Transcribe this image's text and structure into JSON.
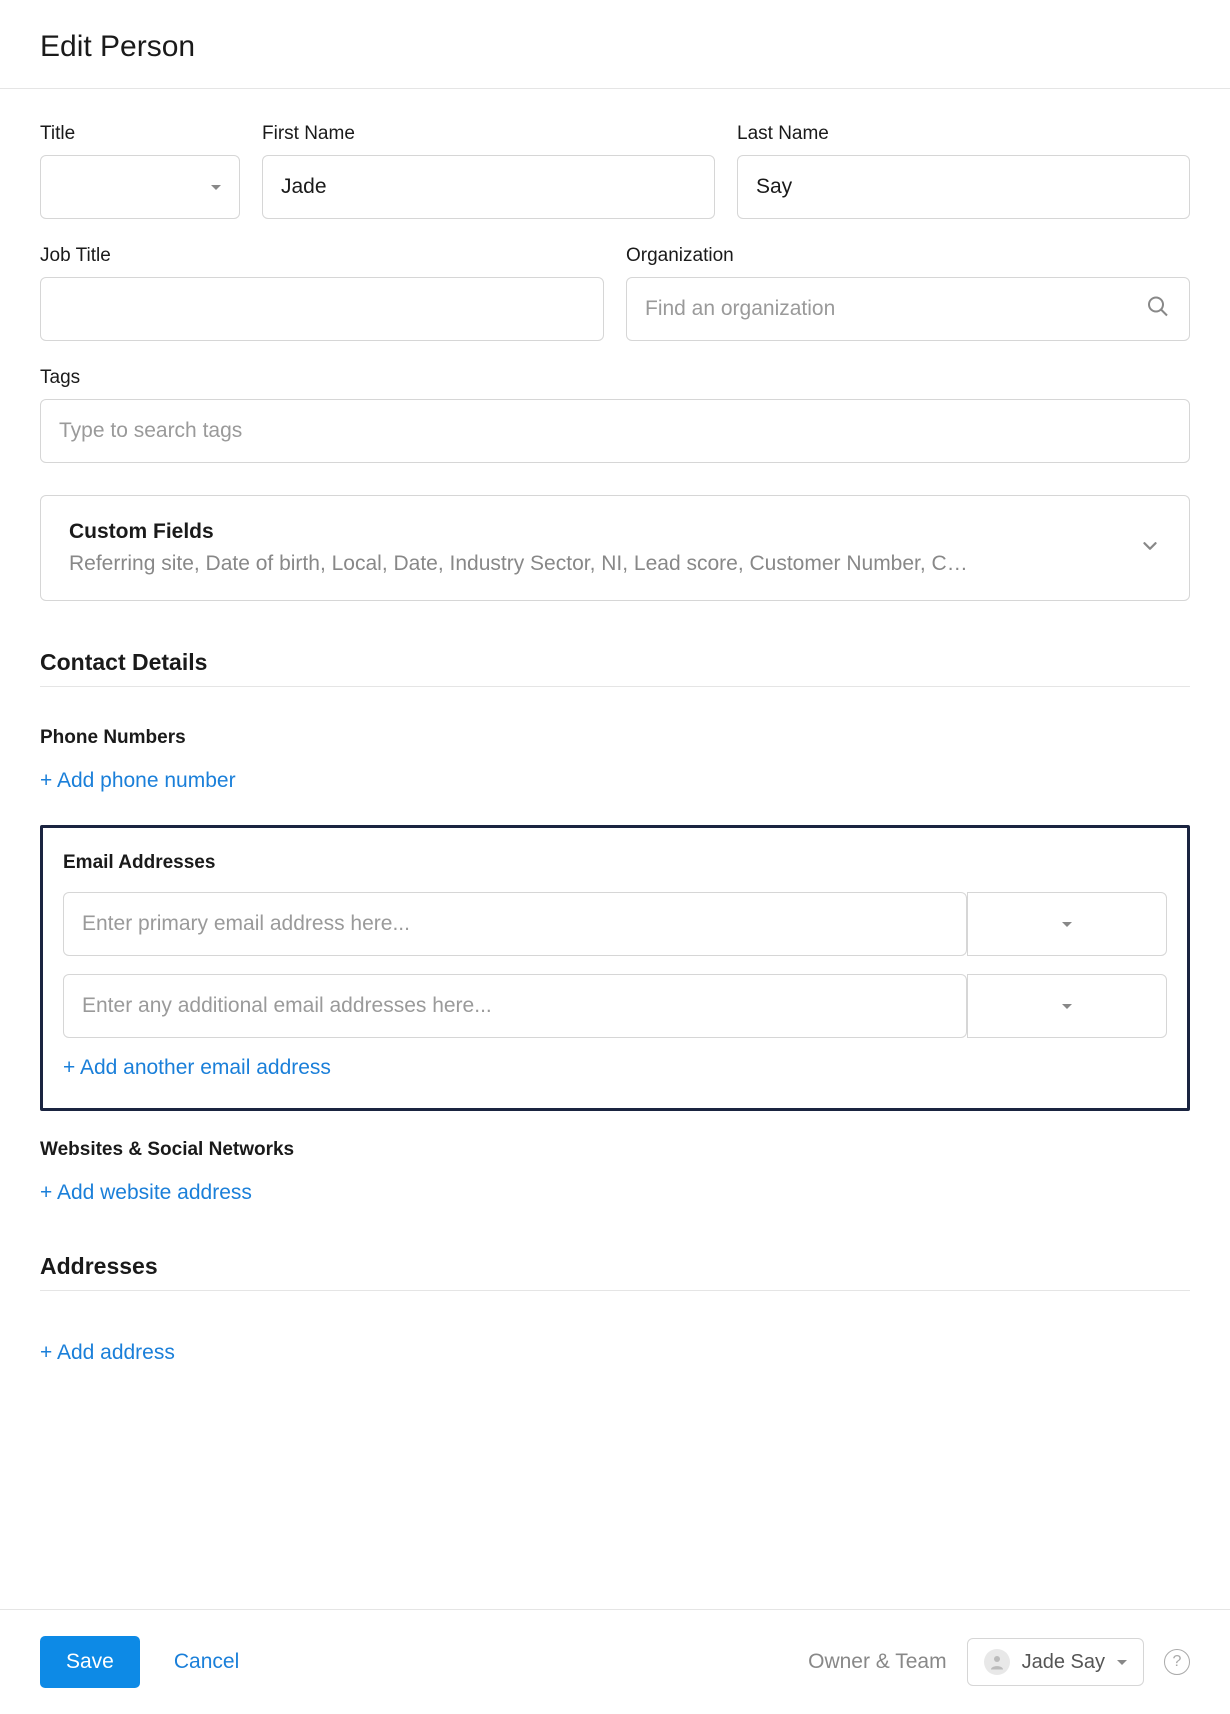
{
  "page": {
    "title": "Edit Person"
  },
  "fields": {
    "title": {
      "label": "Title",
      "value": ""
    },
    "first_name": {
      "label": "First Name",
      "value": "Jade"
    },
    "last_name": {
      "label": "Last Name",
      "value": "Say"
    },
    "job_title": {
      "label": "Job Title",
      "value": ""
    },
    "organization": {
      "label": "Organization",
      "placeholder": "Find an organization",
      "value": ""
    },
    "tags": {
      "label": "Tags",
      "placeholder": "Type to search tags",
      "value": ""
    }
  },
  "custom_fields": {
    "title": "Custom Fields",
    "summary": "Referring site, Date of birth, Local, Date, Industry Sector, NI, Lead score, Customer Number, C…"
  },
  "contact_details": {
    "heading": "Contact Details",
    "phone": {
      "heading": "Phone Numbers",
      "add_label": "+ Add phone number"
    },
    "email": {
      "heading": "Email Addresses",
      "primary_placeholder": "Enter primary email address here...",
      "additional_placeholder": "Enter any additional email addresses here...",
      "add_label": "+ Add another email address"
    },
    "websites": {
      "heading": "Websites & Social Networks",
      "add_label": "+ Add website address"
    }
  },
  "addresses": {
    "heading": "Addresses",
    "add_label": "+ Add address"
  },
  "footer": {
    "save": "Save",
    "cancel": "Cancel",
    "owner_team_label": "Owner & Team",
    "owner_name": "Jade Say",
    "help": "?"
  }
}
